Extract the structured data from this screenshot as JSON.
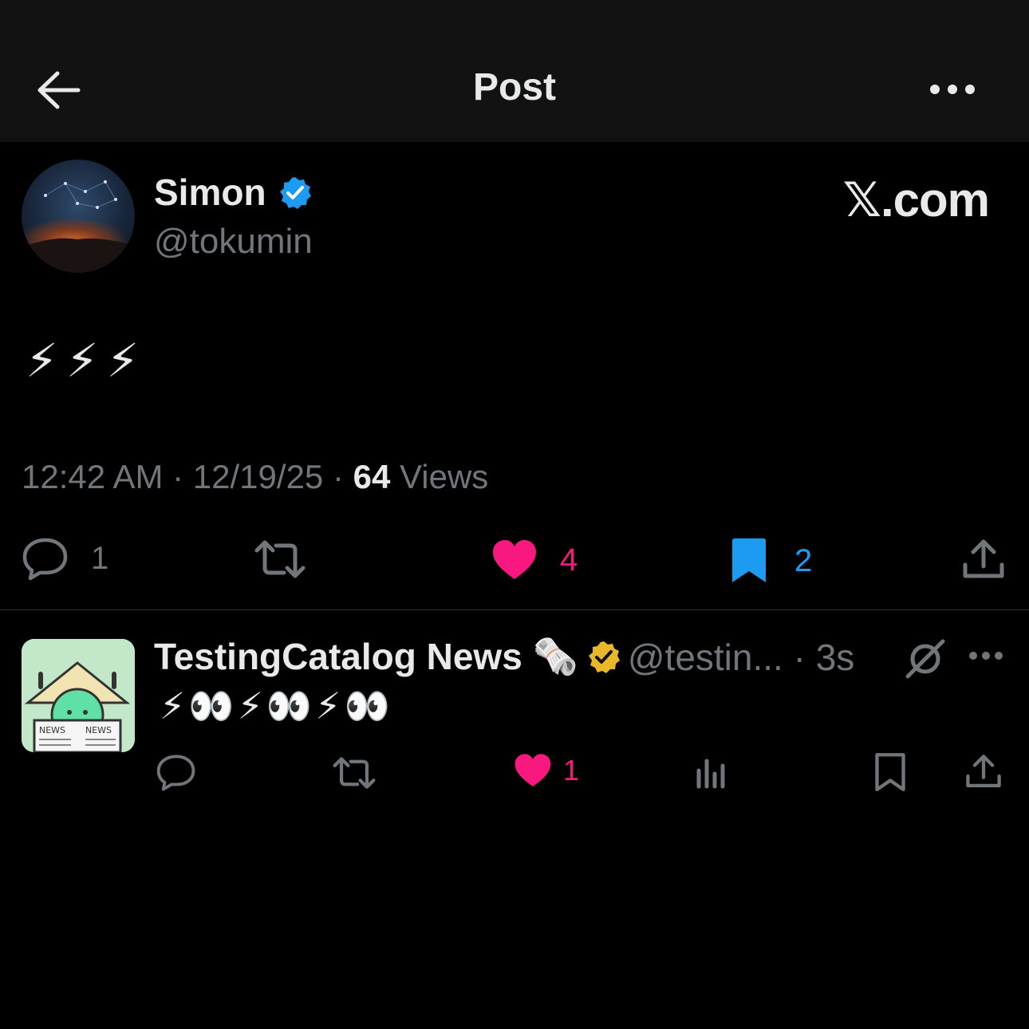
{
  "header": {
    "title": "Post"
  },
  "post": {
    "author_name": "Simon",
    "author_handle": "@tokumin",
    "brand": "𝕏.com",
    "text": "⚡⚡⚡",
    "time": "12:42 AM",
    "date": "12/19/25",
    "views_count": "64",
    "views_label": "Views",
    "replies": "1",
    "likes": "4",
    "bookmarks": "2"
  },
  "reply": {
    "author_name": "TestingCatalog News 🗞️",
    "author_handle": "@testin... · 3s",
    "text": "⚡👀⚡👀⚡👀",
    "likes": "1"
  },
  "colors": {
    "like": "#f91880",
    "bookmark": "#1d9bf0",
    "verified_blue": "#1d9bf0",
    "verified_gold": "#e8b829",
    "muted": "#71767b"
  }
}
